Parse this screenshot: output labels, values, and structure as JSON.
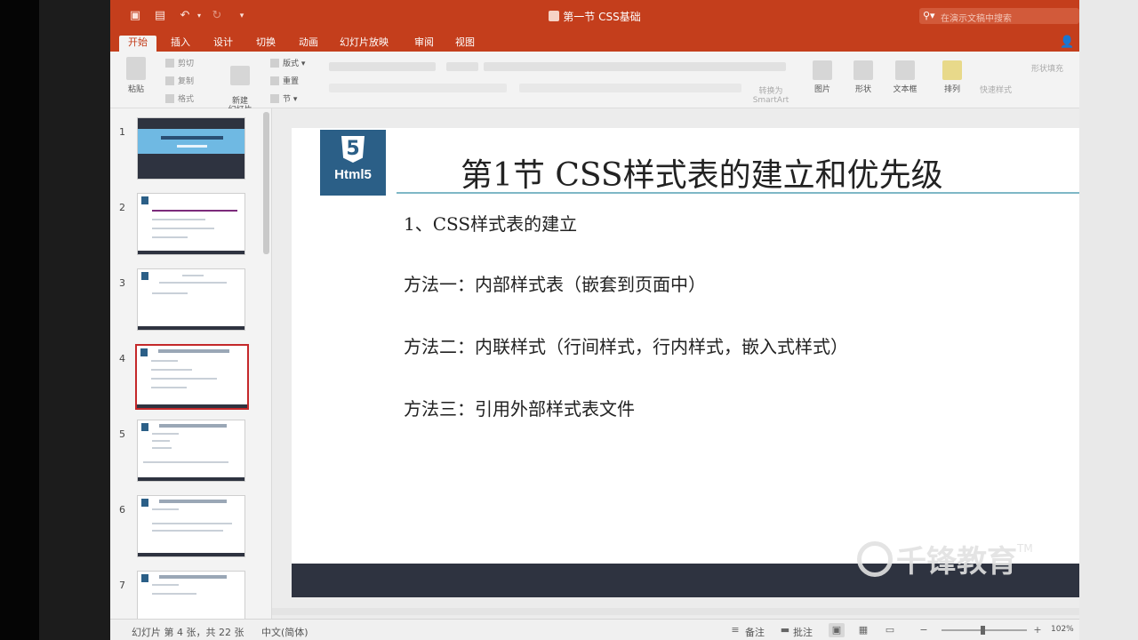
{
  "app": {
    "document_title": "第一节 CSS基础",
    "search_placeholder": "在演示文稿中搜索"
  },
  "tabs": [
    {
      "label": "开始",
      "active": true
    },
    {
      "label": "插入"
    },
    {
      "label": "设计"
    },
    {
      "label": "切换"
    },
    {
      "label": "动画"
    },
    {
      "label": "幻灯片放映"
    },
    {
      "label": "审阅"
    },
    {
      "label": "视图"
    }
  ],
  "ribbon": {
    "paste": "粘贴",
    "cut": "剪切",
    "copy": "复制",
    "format": "格式",
    "new_slide": "新建\n幻灯片",
    "layout": "版式",
    "reset": "重置",
    "section": "节",
    "picture": "图片",
    "shape": "形状",
    "textbox": "文本框",
    "arrange": "排列",
    "convert_smartart": "转换为\nSmartArt",
    "quick_styles": "快速样式",
    "fill": "形状填充"
  },
  "thumbnails": [
    {
      "num": "1",
      "type": "cover"
    },
    {
      "num": "2",
      "type": "content"
    },
    {
      "num": "3",
      "type": "content"
    },
    {
      "num": "4",
      "type": "content",
      "selected": true
    },
    {
      "num": "5",
      "type": "content"
    },
    {
      "num": "6",
      "type": "content"
    },
    {
      "num": "7",
      "type": "content"
    }
  ],
  "slide": {
    "logo_text": "Html5",
    "logo_glyph": "5",
    "title": "第1节 CSS样式表的建立和优先级",
    "lines": [
      "1、CSS样式表的建立",
      "方法一：内部样式表（嵌套到页面中）",
      "方法二：内联样式（行间样式，行内样式，嵌入式样式）",
      "方法三：引用外部样式表文件"
    ],
    "footer_color": "#2e3340",
    "accent_color": "#2b5f87"
  },
  "watermark": {
    "text": "千锋教育",
    "tm": "TM"
  },
  "status": {
    "slide_info": "幻灯片 第 4 张，共 22 张",
    "language": "中文(简体)",
    "notes": "备注",
    "comments": "批注",
    "zoom": "102%"
  },
  "colors": {
    "title_bar": "#c43e1c",
    "selected_thumb_border": "#c4282a"
  }
}
